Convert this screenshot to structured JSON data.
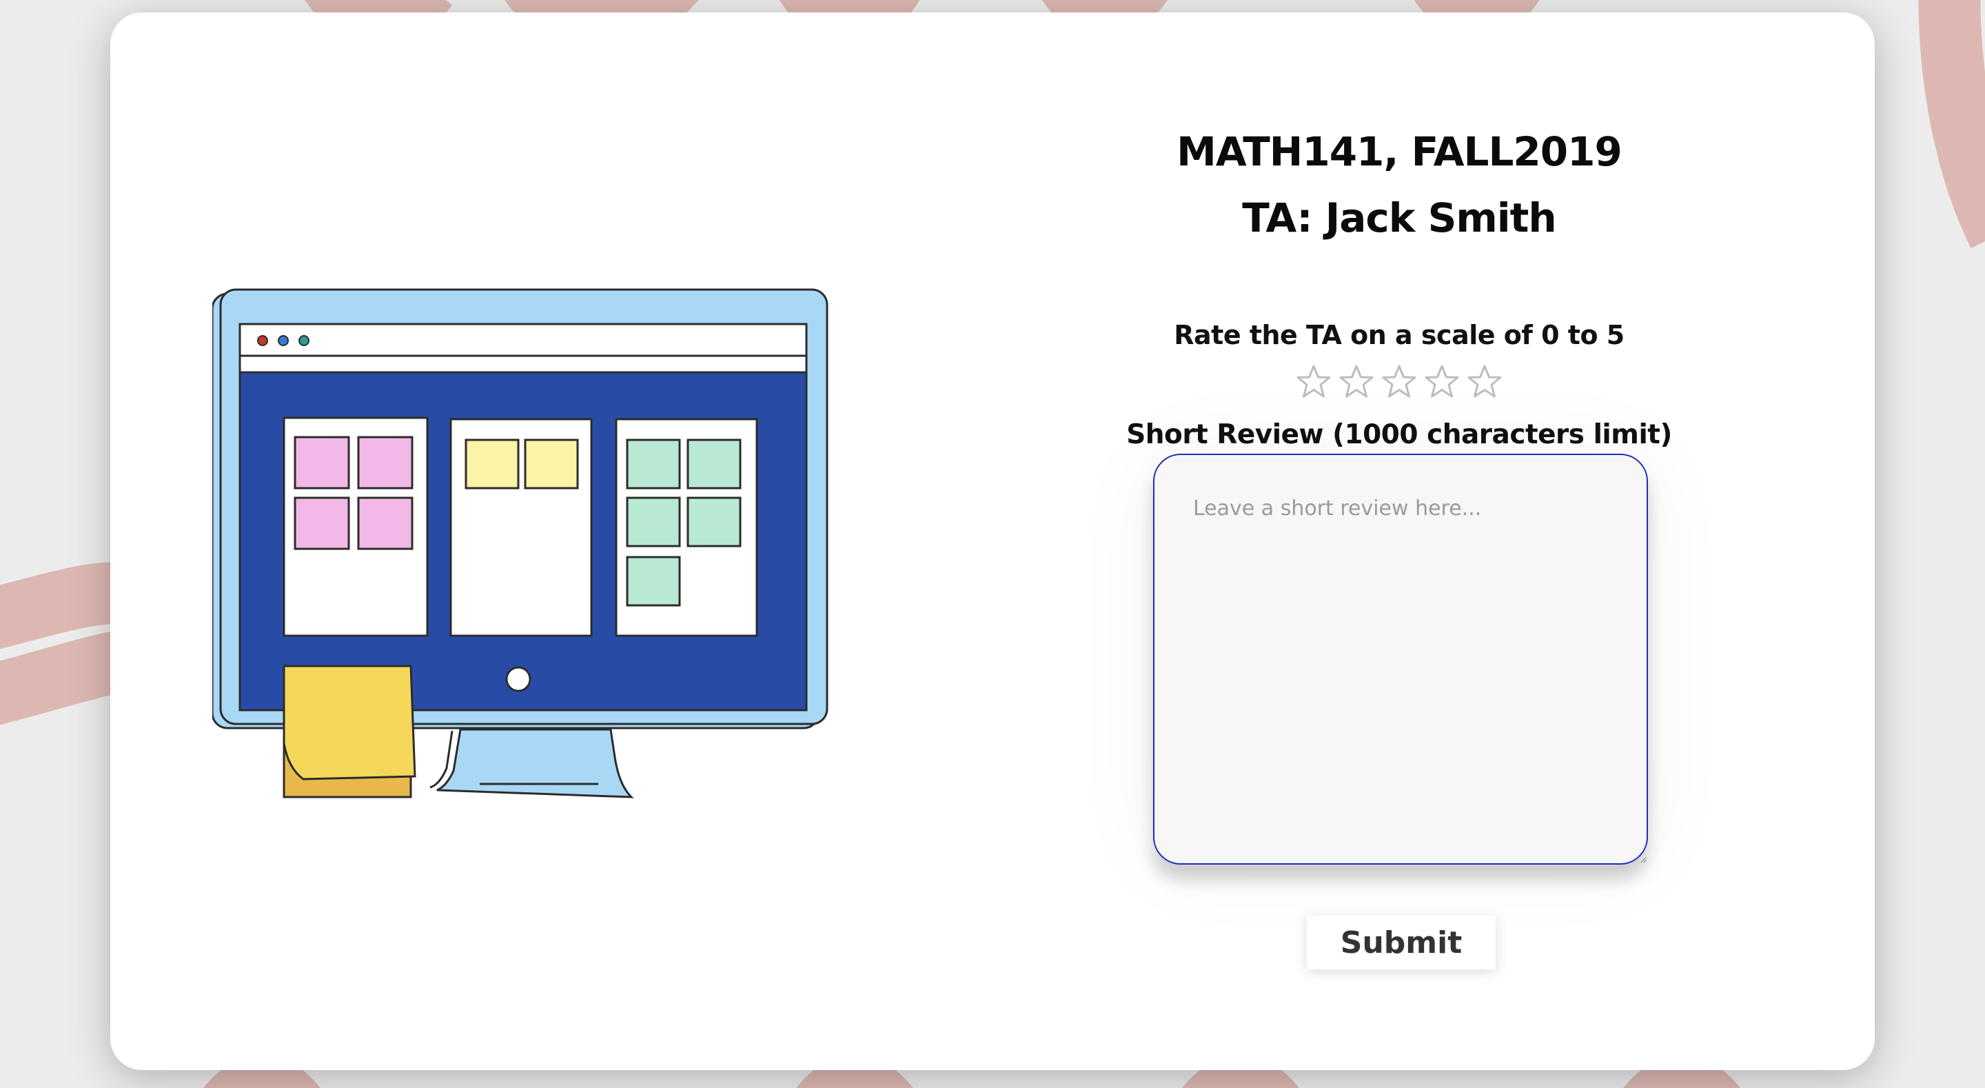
{
  "colors": {
    "page_background": "#ececec",
    "background_swirl": "#dcb3ad",
    "card_background": "#ffffff",
    "textarea_border": "#1f2bbd",
    "textarea_background": "#f7f7f7",
    "star_outline": "#bdbdbd",
    "monitor_frame": "#a9d8f7",
    "screen_blue": "#284ca6",
    "note_pink": "#f2b8e6",
    "note_yellow": "#fbf3a5",
    "note_green": "#b8ead3",
    "sticky_note": "#f5d75a"
  },
  "course": {
    "title": "MATH141, FALL2019",
    "ta_line": "TA: Jack Smith"
  },
  "rating": {
    "label": "Rate the TA on a scale of 0 to 5",
    "value": 0,
    "max": 5,
    "star_icon": "star-outline-icon"
  },
  "review": {
    "label": "Short Review (1000 characters limit)",
    "placeholder": "Leave a short review here...",
    "value": ""
  },
  "submit_label": "Submit",
  "illustration": {
    "icon": "desktop-kanban-illustration"
  }
}
